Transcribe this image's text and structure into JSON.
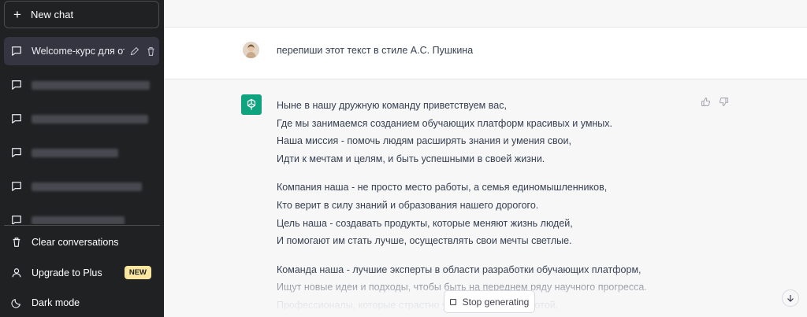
{
  "sidebar": {
    "new_chat_label": "New chat",
    "active_chat_title": "Welcome-курс для отд",
    "clear_label": "Clear conversations",
    "upgrade_label": "Upgrade to Plus",
    "new_badge": "NEW",
    "dark_mode_label": "Dark mode"
  },
  "user_message": "перепиши этот текст в стиле А.С. Пушкина",
  "bot_message": {
    "paragraphs": [
      [
        "Ныне в нашу дружную команду приветствуем вас,",
        "Где мы занимаемся созданием обучающих платформ красивых и умных.",
        "Наша миссия - помочь людям расширять знания и умения свои,",
        "Идти к мечтам и целям, и быть успешными в своей жизни."
      ],
      [
        "Компания наша - не просто место работы, а семья единомышленников,",
        "Кто верит в силу знаний и образования нашего дорогого.",
        "Цель наша - создавать продукты, которые меняют жизнь людей,",
        "И помогают им стать лучше, осуществлять свои мечты светлые."
      ],
      [
        "Команда наша - лучшие эксперты в области разработки обучающих платформ,",
        "Ищут новые идеи и подходы, чтобы быть на переднем ряду научного прогресса.",
        "Профессионалы, которые страстно увлечены своей работой,"
      ]
    ]
  },
  "controls": {
    "stop_label": "Stop generating"
  },
  "colors": {
    "sidebar_bg": "#202123",
    "accent": "#10a37f",
    "badge": "#fae69e"
  }
}
